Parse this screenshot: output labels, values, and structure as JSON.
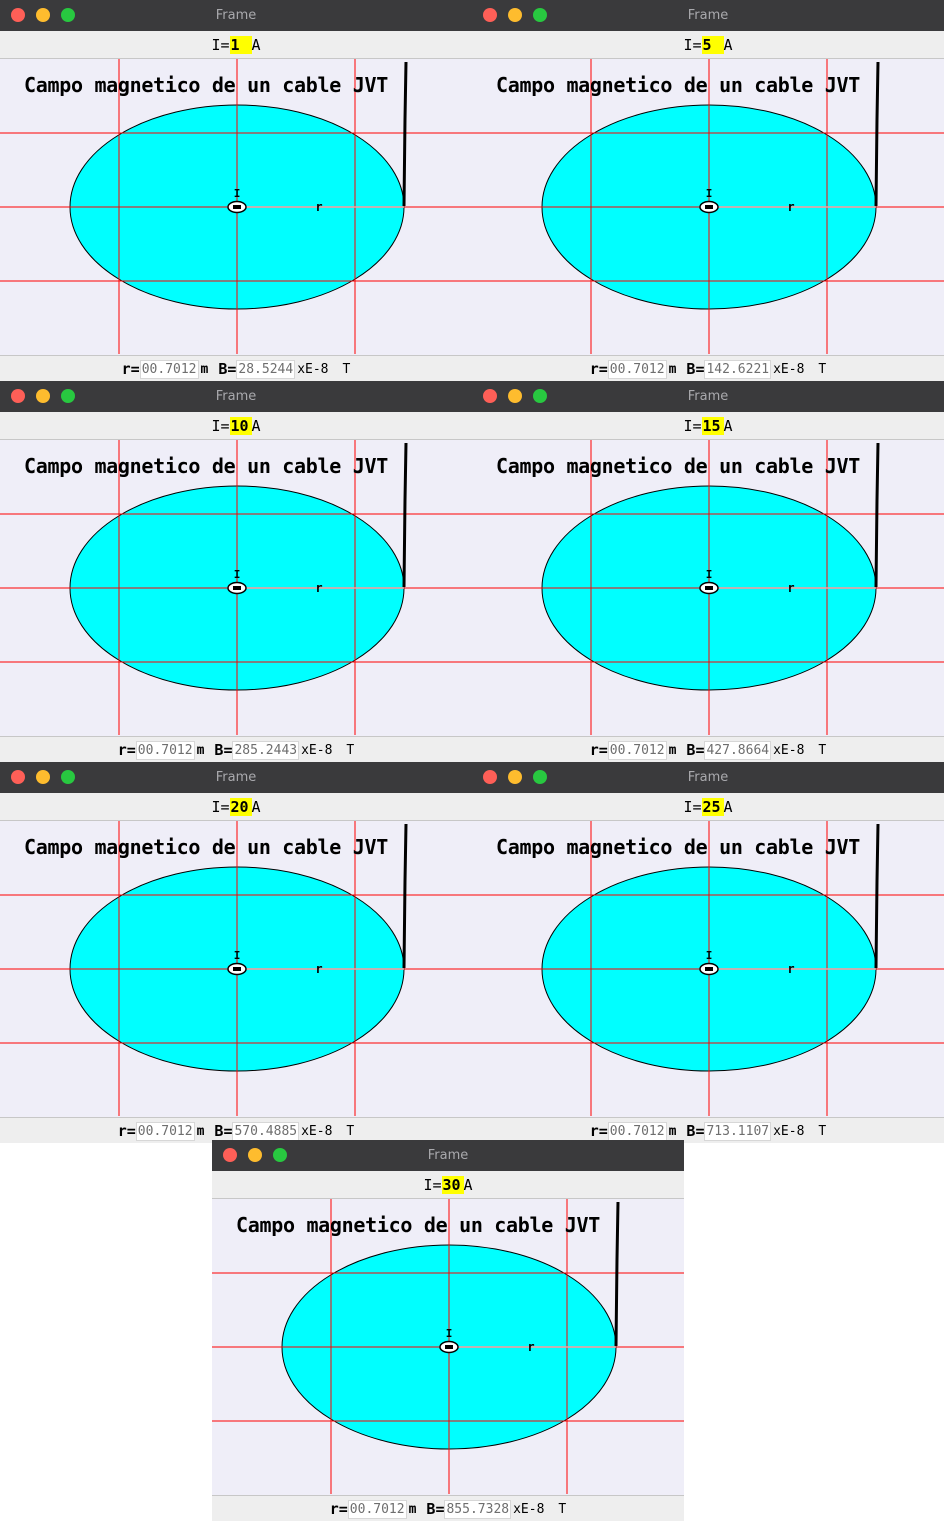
{
  "colors": {
    "titlebar": "#3a3a3c",
    "plot_background": "#efeef8",
    "ellipse_fill": "#00ffff",
    "grid_line": "#ff0000",
    "current_field": "#ffff00"
  },
  "windows": [
    {
      "title": "Frame",
      "current_label": "I=",
      "current_value": "1",
      "current_unit": "A",
      "plot_title": "Campo magnetico de un cable JVT",
      "r_label": "r=",
      "r_value": "00.7012",
      "r_unit": "m",
      "b_label": "B=",
      "b_value": "28.5244",
      "b_exp": "xE-8",
      "b_unit": "T",
      "center_label": "I",
      "radius_label": "r"
    },
    {
      "title": "Frame",
      "current_label": "I=",
      "current_value": "5",
      "current_unit": "A",
      "plot_title": "Campo magnetico de un cable JVT",
      "r_label": "r=",
      "r_value": "00.7012",
      "r_unit": "m",
      "b_label": "B=",
      "b_value": "142.6221",
      "b_exp": "xE-8",
      "b_unit": "T",
      "center_label": "I",
      "radius_label": "r"
    },
    {
      "title": "Frame",
      "current_label": "I=",
      "current_value": "10",
      "current_unit": "A",
      "plot_title": "Campo magnetico de un cable JVT",
      "r_label": "r=",
      "r_value": "00.7012",
      "r_unit": "m",
      "b_label": "B=",
      "b_value": "285.2443",
      "b_exp": "xE-8",
      "b_unit": "T",
      "center_label": "I",
      "radius_label": "r"
    },
    {
      "title": "Frame",
      "current_label": "I=",
      "current_value": "15",
      "current_unit": "A",
      "plot_title": "Campo magnetico de un cable JVT",
      "r_label": "r=",
      "r_value": "00.7012",
      "r_unit": "m",
      "b_label": "B=",
      "b_value": "427.8664",
      "b_exp": "xE-8",
      "b_unit": "T",
      "center_label": "I",
      "radius_label": "r"
    },
    {
      "title": "Frame",
      "current_label": "I=",
      "current_value": "20",
      "current_unit": "A",
      "plot_title": "Campo magnetico de un cable JVT",
      "r_label": "r=",
      "r_value": "00.7012",
      "r_unit": "m",
      "b_label": "B=",
      "b_value": "570.4885",
      "b_exp": "xE-8",
      "b_unit": "T",
      "center_label": "I",
      "radius_label": "r"
    },
    {
      "title": "Frame",
      "current_label": "I=",
      "current_value": "25",
      "current_unit": "A",
      "plot_title": "Campo magnetico de un cable JVT",
      "r_label": "r=",
      "r_value": "00.7012",
      "r_unit": "m",
      "b_label": "B=",
      "b_value": "713.1107",
      "b_exp": "xE-8",
      "b_unit": "T",
      "center_label": "I",
      "radius_label": "r"
    },
    {
      "title": "Frame",
      "current_label": "I=",
      "current_value": "30",
      "current_unit": "A",
      "plot_title": "Campo magnetico de un cable JVT",
      "r_label": "r=",
      "r_value": "00.7012",
      "r_unit": "m",
      "b_label": "B=",
      "b_value": "855.7328",
      "b_exp": "xE-8",
      "b_unit": "T",
      "center_label": "I",
      "radius_label": "r"
    }
  ]
}
